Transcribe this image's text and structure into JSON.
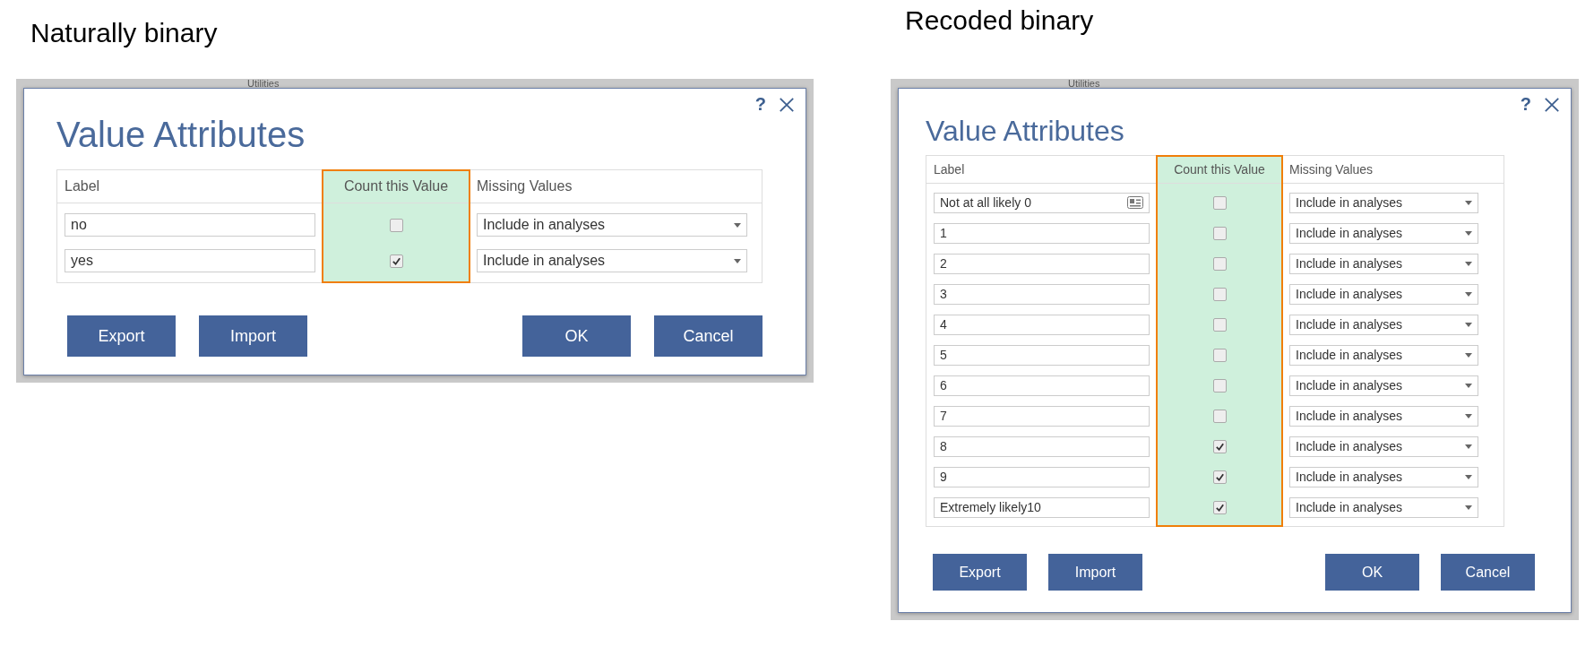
{
  "panels": [
    {
      "kind": "large",
      "heading": "Naturally binary",
      "background_tab": "Utilities",
      "dialog": {
        "help": "?",
        "title": "Value Attributes",
        "columns": [
          "Label",
          "Count this Value",
          "Missing Values"
        ],
        "rows": [
          {
            "label": "no",
            "label_icon": false,
            "checked": false,
            "missing": "Include in analyses"
          },
          {
            "label": "yes",
            "label_icon": false,
            "checked": true,
            "missing": "Include in analyses"
          }
        ],
        "buttons_left": [
          "Export",
          "Import"
        ],
        "buttons_right": [
          "OK",
          "Cancel"
        ]
      }
    },
    {
      "kind": "compact",
      "heading": "Recoded binary",
      "background_tab": "Utilities",
      "dialog": {
        "help": "?",
        "title": "Value Attributes",
        "columns": [
          "Label",
          "Count this Value",
          "Missing Values"
        ],
        "rows": [
          {
            "label": "Not at all likely 0",
            "label_icon": true,
            "checked": false,
            "missing": "Include in analyses"
          },
          {
            "label": "1",
            "label_icon": false,
            "checked": false,
            "missing": "Include in analyses"
          },
          {
            "label": "2",
            "label_icon": false,
            "checked": false,
            "missing": "Include in analyses"
          },
          {
            "label": "3",
            "label_icon": false,
            "checked": false,
            "missing": "Include in analyses"
          },
          {
            "label": "4",
            "label_icon": false,
            "checked": false,
            "missing": "Include in analyses"
          },
          {
            "label": "5",
            "label_icon": false,
            "checked": false,
            "missing": "Include in analyses"
          },
          {
            "label": "6",
            "label_icon": false,
            "checked": false,
            "missing": "Include in analyses"
          },
          {
            "label": "7",
            "label_icon": false,
            "checked": false,
            "missing": "Include in analyses"
          },
          {
            "label": "8",
            "label_icon": false,
            "checked": true,
            "missing": "Include in analyses"
          },
          {
            "label": "9",
            "label_icon": false,
            "checked": true,
            "missing": "Include in analyses"
          },
          {
            "label": "Extremely likely10",
            "label_icon": false,
            "checked": true,
            "missing": "Include in analyses"
          }
        ],
        "buttons_left": [
          "Export",
          "Import"
        ],
        "buttons_right": [
          "OK",
          "Cancel"
        ]
      }
    }
  ]
}
